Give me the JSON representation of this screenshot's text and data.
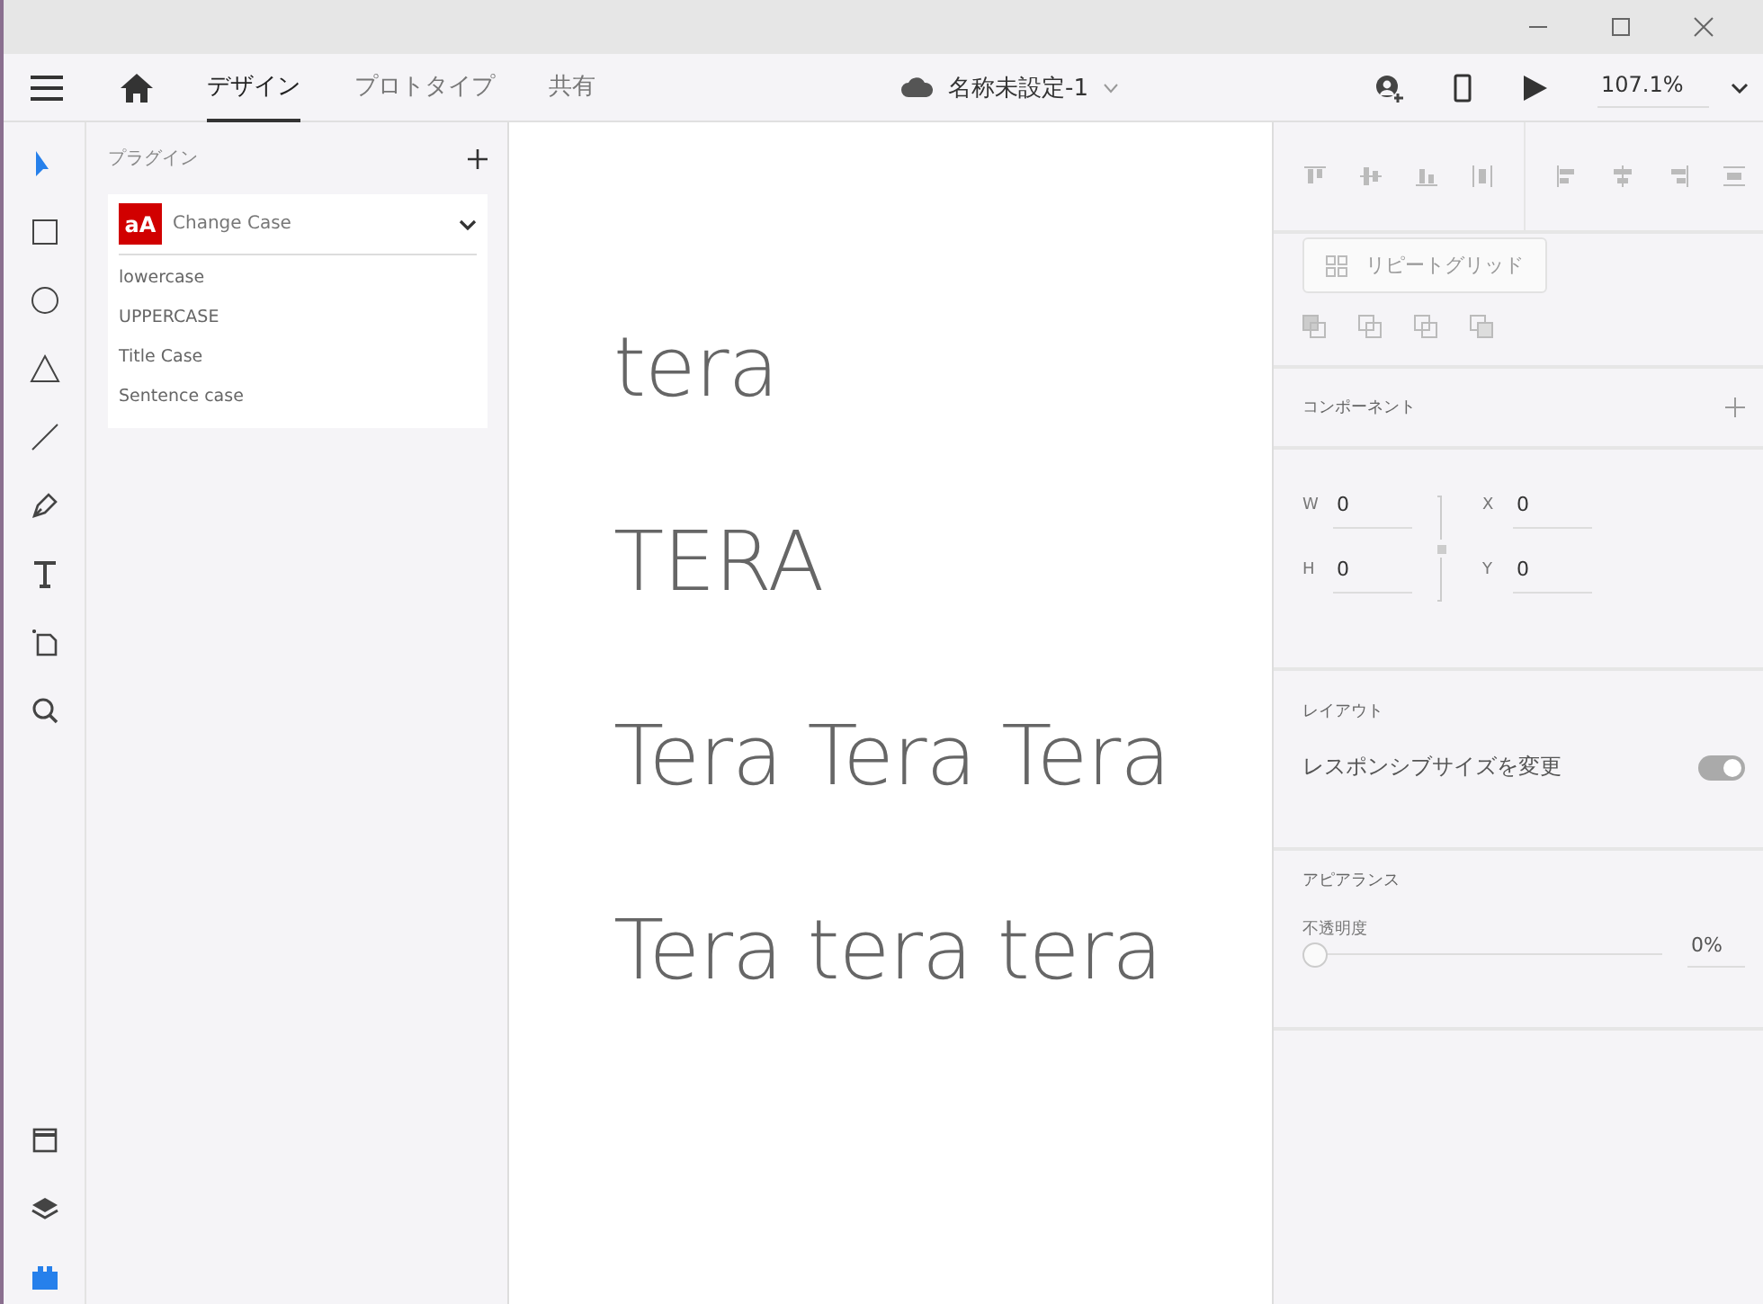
{
  "top_bar": {
    "tabs": [
      {
        "label": "デザイン",
        "selected": true
      },
      {
        "label": "プロトタイプ",
        "selected": false
      },
      {
        "label": "共有",
        "selected": false
      }
    ],
    "document_title": "名称未設定-1",
    "zoom": "107.1%"
  },
  "tools": [
    {
      "kind": "select",
      "selected": true
    },
    {
      "kind": "rectangle",
      "selected": false
    },
    {
      "kind": "ellipse",
      "selected": false
    },
    {
      "kind": "triangle",
      "selected": false
    },
    {
      "kind": "line",
      "selected": false
    },
    {
      "kind": "pen",
      "selected": false
    },
    {
      "kind": "text",
      "selected": false
    },
    {
      "kind": "artboard",
      "selected": false
    },
    {
      "kind": "zoom",
      "selected": false
    }
  ],
  "bottom_tools": [
    {
      "kind": "assets",
      "selected": false
    },
    {
      "kind": "layers",
      "selected": false
    },
    {
      "kind": "plugins",
      "selected": true
    }
  ],
  "plugins_panel": {
    "title": "プラグイン",
    "plugin": {
      "badge": "aA",
      "name": "Change Case",
      "expanded": true,
      "commands": [
        "lowercase",
        "UPPERCASE",
        "Title Case",
        "Sentence case"
      ]
    }
  },
  "canvas": {
    "texts": [
      "tera",
      "TERA",
      "Tera Tera Tera",
      "Tera tera tera"
    ]
  },
  "properties": {
    "repeat_grid": "リピートグリッド",
    "components_title": "コンポーネント",
    "fields": [
      {
        "label": "W",
        "value": "0"
      },
      {
        "label": "X",
        "value": "0"
      },
      {
        "label": "H",
        "value": "0"
      },
      {
        "label": "Y",
        "value": "0"
      }
    ],
    "layout_title": "レイアウト",
    "responsive_resize": {
      "label": "レスポンシブサイズを変更",
      "on": true
    },
    "appearance_title": "アピアランス",
    "opacity": {
      "label": "不透明度",
      "level": 0,
      "reading": "0%"
    }
  }
}
